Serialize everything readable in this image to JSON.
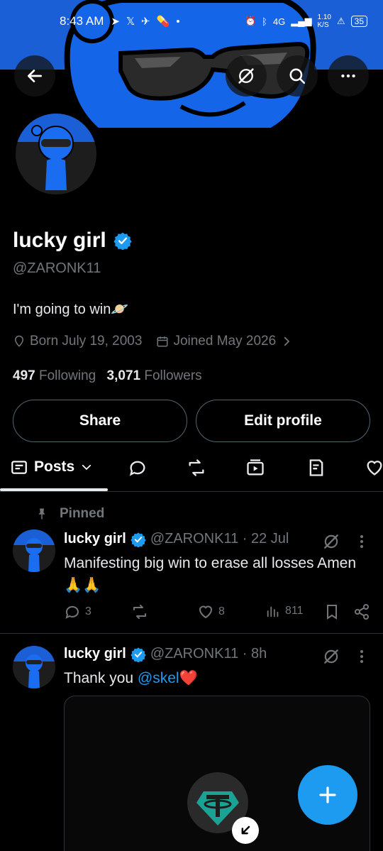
{
  "status_bar": {
    "time": "8:43 AM",
    "network": "4G",
    "speed_top": "1.10",
    "speed_bottom": "K/S",
    "battery": "35"
  },
  "profile": {
    "name": "lucky girl",
    "handle": "@ZARONK11",
    "bio": "I'm going to win🪐",
    "born": "Born July 19, 2003",
    "joined": "Joined May 2026",
    "following_count": "497",
    "following_label": "Following",
    "followers_count": "3,071",
    "followers_label": "Followers"
  },
  "buttons": {
    "share": "Share",
    "edit_profile": "Edit profile"
  },
  "tabs": {
    "posts": "Posts"
  },
  "pinned_label": "Pinned",
  "posts": [
    {
      "name": "lucky girl",
      "meta": "@ZARONK11 · 22 Jul",
      "text": "Manifesting big win to erase all losses Amen🙏🙏",
      "replies": "3",
      "likes": "8",
      "views": "811"
    },
    {
      "name": "lucky girl",
      "meta": "@ZARONK11 · 8h",
      "text_before": "Thank you ",
      "mention": "@skel",
      "text_after": "❤️"
    }
  ],
  "colors": {
    "accent": "#1d9bf0",
    "banner_blue": "#1a5fd6",
    "muted": "#71767b"
  },
  "icons": [
    "back-arrow-icon",
    "grok-icon",
    "search-icon",
    "more-icon",
    "verified-icon",
    "location-icon",
    "calendar-icon",
    "chevron-right-icon",
    "posts-tab-icon",
    "reply-icon",
    "repost-icon",
    "video-icon",
    "article-icon",
    "heart-icon",
    "pin-icon",
    "views-icon",
    "bookmark-icon",
    "share-icon",
    "compose-plus-icon"
  ]
}
